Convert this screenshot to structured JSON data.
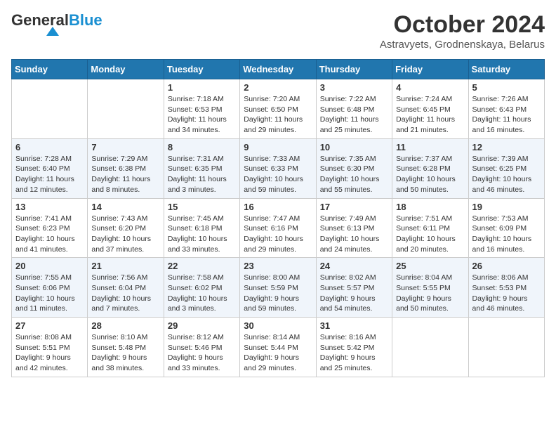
{
  "header": {
    "logo_general": "General",
    "logo_blue": "Blue",
    "month_title": "October 2024",
    "location": "Astravyets, Grodnenskaya, Belarus"
  },
  "calendar": {
    "days_of_week": [
      "Sunday",
      "Monday",
      "Tuesday",
      "Wednesday",
      "Thursday",
      "Friday",
      "Saturday"
    ],
    "weeks": [
      [
        {
          "day": "",
          "info": ""
        },
        {
          "day": "",
          "info": ""
        },
        {
          "day": "1",
          "info": "Sunrise: 7:18 AM\nSunset: 6:53 PM\nDaylight: 11 hours\nand 34 minutes."
        },
        {
          "day": "2",
          "info": "Sunrise: 7:20 AM\nSunset: 6:50 PM\nDaylight: 11 hours\nand 29 minutes."
        },
        {
          "day": "3",
          "info": "Sunrise: 7:22 AM\nSunset: 6:48 PM\nDaylight: 11 hours\nand 25 minutes."
        },
        {
          "day": "4",
          "info": "Sunrise: 7:24 AM\nSunset: 6:45 PM\nDaylight: 11 hours\nand 21 minutes."
        },
        {
          "day": "5",
          "info": "Sunrise: 7:26 AM\nSunset: 6:43 PM\nDaylight: 11 hours\nand 16 minutes."
        }
      ],
      [
        {
          "day": "6",
          "info": "Sunrise: 7:28 AM\nSunset: 6:40 PM\nDaylight: 11 hours\nand 12 minutes."
        },
        {
          "day": "7",
          "info": "Sunrise: 7:29 AM\nSunset: 6:38 PM\nDaylight: 11 hours\nand 8 minutes."
        },
        {
          "day": "8",
          "info": "Sunrise: 7:31 AM\nSunset: 6:35 PM\nDaylight: 11 hours\nand 3 minutes."
        },
        {
          "day": "9",
          "info": "Sunrise: 7:33 AM\nSunset: 6:33 PM\nDaylight: 10 hours\nand 59 minutes."
        },
        {
          "day": "10",
          "info": "Sunrise: 7:35 AM\nSunset: 6:30 PM\nDaylight: 10 hours\nand 55 minutes."
        },
        {
          "day": "11",
          "info": "Sunrise: 7:37 AM\nSunset: 6:28 PM\nDaylight: 10 hours\nand 50 minutes."
        },
        {
          "day": "12",
          "info": "Sunrise: 7:39 AM\nSunset: 6:25 PM\nDaylight: 10 hours\nand 46 minutes."
        }
      ],
      [
        {
          "day": "13",
          "info": "Sunrise: 7:41 AM\nSunset: 6:23 PM\nDaylight: 10 hours\nand 41 minutes."
        },
        {
          "day": "14",
          "info": "Sunrise: 7:43 AM\nSunset: 6:20 PM\nDaylight: 10 hours\nand 37 minutes."
        },
        {
          "day": "15",
          "info": "Sunrise: 7:45 AM\nSunset: 6:18 PM\nDaylight: 10 hours\nand 33 minutes."
        },
        {
          "day": "16",
          "info": "Sunrise: 7:47 AM\nSunset: 6:16 PM\nDaylight: 10 hours\nand 29 minutes."
        },
        {
          "day": "17",
          "info": "Sunrise: 7:49 AM\nSunset: 6:13 PM\nDaylight: 10 hours\nand 24 minutes."
        },
        {
          "day": "18",
          "info": "Sunrise: 7:51 AM\nSunset: 6:11 PM\nDaylight: 10 hours\nand 20 minutes."
        },
        {
          "day": "19",
          "info": "Sunrise: 7:53 AM\nSunset: 6:09 PM\nDaylight: 10 hours\nand 16 minutes."
        }
      ],
      [
        {
          "day": "20",
          "info": "Sunrise: 7:55 AM\nSunset: 6:06 PM\nDaylight: 10 hours\nand 11 minutes."
        },
        {
          "day": "21",
          "info": "Sunrise: 7:56 AM\nSunset: 6:04 PM\nDaylight: 10 hours\nand 7 minutes."
        },
        {
          "day": "22",
          "info": "Sunrise: 7:58 AM\nSunset: 6:02 PM\nDaylight: 10 hours\nand 3 minutes."
        },
        {
          "day": "23",
          "info": "Sunrise: 8:00 AM\nSunset: 5:59 PM\nDaylight: 9 hours\nand 59 minutes."
        },
        {
          "day": "24",
          "info": "Sunrise: 8:02 AM\nSunset: 5:57 PM\nDaylight: 9 hours\nand 54 minutes."
        },
        {
          "day": "25",
          "info": "Sunrise: 8:04 AM\nSunset: 5:55 PM\nDaylight: 9 hours\nand 50 minutes."
        },
        {
          "day": "26",
          "info": "Sunrise: 8:06 AM\nSunset: 5:53 PM\nDaylight: 9 hours\nand 46 minutes."
        }
      ],
      [
        {
          "day": "27",
          "info": "Sunrise: 8:08 AM\nSunset: 5:51 PM\nDaylight: 9 hours\nand 42 minutes."
        },
        {
          "day": "28",
          "info": "Sunrise: 8:10 AM\nSunset: 5:48 PM\nDaylight: 9 hours\nand 38 minutes."
        },
        {
          "day": "29",
          "info": "Sunrise: 8:12 AM\nSunset: 5:46 PM\nDaylight: 9 hours\nand 33 minutes."
        },
        {
          "day": "30",
          "info": "Sunrise: 8:14 AM\nSunset: 5:44 PM\nDaylight: 9 hours\nand 29 minutes."
        },
        {
          "day": "31",
          "info": "Sunrise: 8:16 AM\nSunset: 5:42 PM\nDaylight: 9 hours\nand 25 minutes."
        },
        {
          "day": "",
          "info": ""
        },
        {
          "day": "",
          "info": ""
        }
      ]
    ]
  }
}
